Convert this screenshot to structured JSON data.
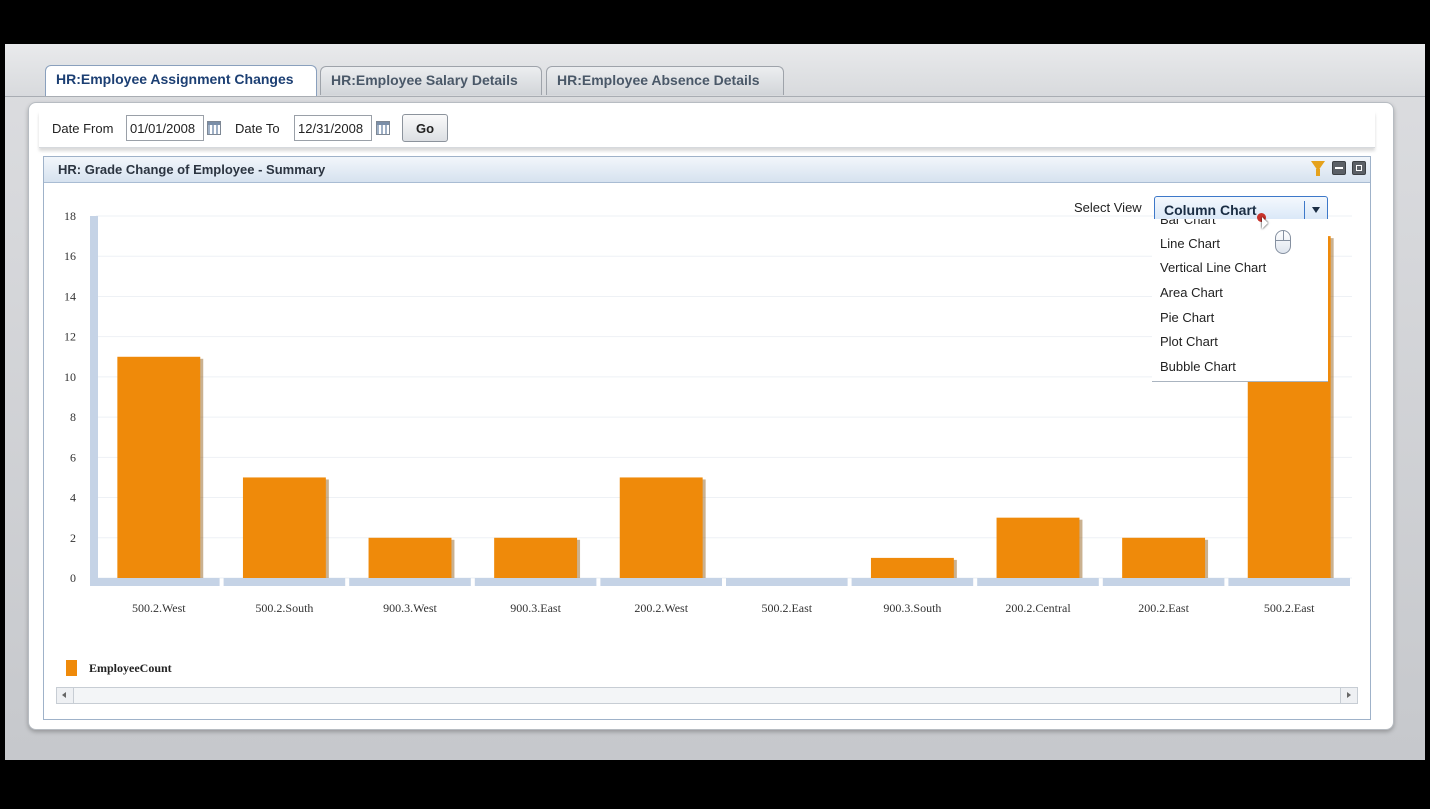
{
  "tabs": [
    {
      "label": "HR:Employee Assignment Changes",
      "active": true
    },
    {
      "label": "HR:Employee Salary Details",
      "active": false
    },
    {
      "label": "HR:Employee Absence Details",
      "active": false
    }
  ],
  "filters": {
    "date_from_label": "Date From",
    "date_from_value": "01/01/2008",
    "date_to_label": "Date To",
    "date_to_value": "12/31/2008",
    "go_label": "Go"
  },
  "panel": {
    "title": "HR: Grade Change of Employee - Summary",
    "icons": [
      "filter-icon",
      "minimize-icon",
      "maximize-icon"
    ]
  },
  "select_view": {
    "label": "Select View",
    "value": "Column Chart",
    "options": [
      "Bar Chart",
      "Line Chart",
      "Vertical Line Chart",
      "Area Chart",
      "Pie Chart",
      "Plot Chart",
      "Bubble Chart"
    ]
  },
  "colors": {
    "bar": "#ef8a0a",
    "axis": "#c5d3e6",
    "accent": "#3d78c9"
  },
  "chart_data": {
    "type": "bar",
    "title": "",
    "xlabel": "",
    "ylabel": "",
    "categories": [
      "500.2.West",
      "500.2.South",
      "900.3.West",
      "900.3.East",
      "200.2.West",
      "500.2.East",
      "900.3.South",
      "200.2.Central",
      "200.2.East",
      "500.2.East"
    ],
    "series": [
      {
        "name": "EmployeeCount",
        "values": [
          11,
          5,
          2,
          2,
          5,
          0,
          1,
          3,
          2,
          17
        ]
      }
    ],
    "ylim": [
      0,
      18
    ],
    "yticks": [
      0,
      2,
      4,
      6,
      8,
      10,
      12,
      14,
      16,
      18
    ],
    "grid": true,
    "legend": "bottom-left"
  }
}
